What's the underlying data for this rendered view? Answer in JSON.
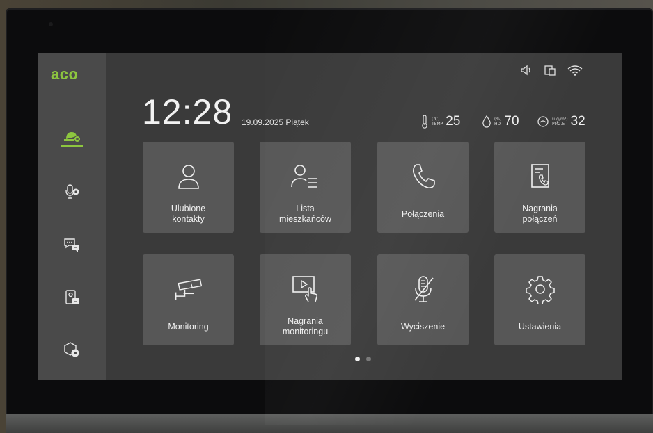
{
  "brand": {
    "logo_text": "aco",
    "accent_color": "#8dc63f"
  },
  "sidebar": {
    "items": [
      {
        "name": "intercom-icon",
        "active": true
      },
      {
        "name": "microphone-settings-icon",
        "active": false
      },
      {
        "name": "messages-icon",
        "active": false
      },
      {
        "name": "door-station-icon",
        "active": false
      },
      {
        "name": "settings-hexagon-icon",
        "active": false
      }
    ]
  },
  "status_bar": {
    "icons": [
      "speaker-icon",
      "device-link-icon",
      "wifi-icon"
    ]
  },
  "clock": {
    "time": "12:28",
    "date": "19.09.2025 Piątek"
  },
  "sensors": [
    {
      "icon": "thermometer-icon",
      "unit": "(℃)",
      "label": "TEMP",
      "value": "25"
    },
    {
      "icon": "humidity-drop-icon",
      "unit": "(%)",
      "label": "HD",
      "value": "70"
    },
    {
      "icon": "air-quality-icon",
      "unit": "(ug/m³)",
      "label": "PM2.5",
      "value": "32"
    }
  ],
  "tiles": [
    {
      "icon": "user-icon",
      "label": "Ulubione\nkontakty"
    },
    {
      "icon": "resident-list-icon",
      "label": "Lista\nmieszkańców"
    },
    {
      "icon": "phone-icon",
      "label": "Połączenia"
    },
    {
      "icon": "call-recording-icon",
      "label": "Nagrania\npołączeń"
    },
    {
      "icon": "camera-icon",
      "label": "Monitoring"
    },
    {
      "icon": "video-touch-icon",
      "label": "Nagrania\nmonitoringu"
    },
    {
      "icon": "mic-muted-icon",
      "label": "Wyciszenie"
    },
    {
      "icon": "gear-icon",
      "label": "Ustawienia"
    }
  ],
  "pagination": {
    "current": 1,
    "total": 2
  }
}
